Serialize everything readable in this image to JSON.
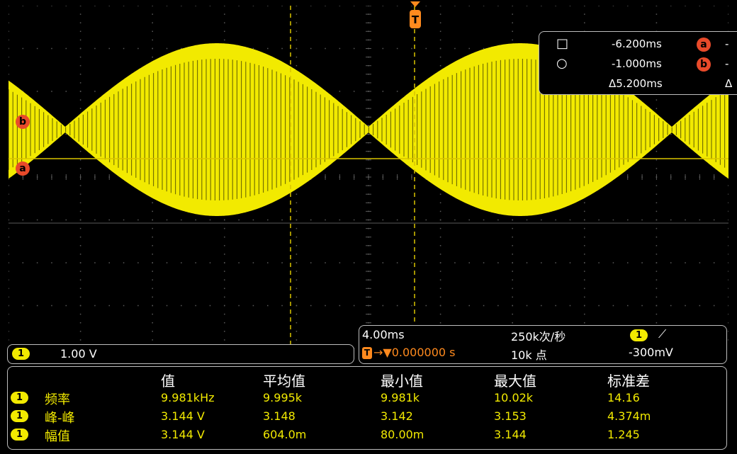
{
  "trigger_marker": "T",
  "cursor_a_label": "a",
  "cursor_b_label": "b",
  "cursor_readout": {
    "row1_symbol": "□",
    "row1_value": "-6.200ms",
    "row1_badge": "a",
    "row2_symbol": "○",
    "row2_value": "-1.000ms",
    "row2_badge": "b",
    "delta_value": "Δ5.200ms",
    "trailing_dash": "-",
    "trailing_delta": "Δ"
  },
  "channel": {
    "badge": "1",
    "scale": "1.00 V"
  },
  "timebase": {
    "time_per_div": "4.00ms",
    "sample_rate": "250k次/秒",
    "trigger_badge": "1",
    "trigger_slope": "⟋",
    "trigger_icon": "T",
    "trigger_offset": "→▼0.000000 s",
    "record_length": "10k 点",
    "trigger_level": "-300mV"
  },
  "measurements": {
    "headers": [
      "值",
      "平均值",
      "最小值",
      "最大值",
      "标准差"
    ],
    "rows": [
      {
        "badge": "1",
        "name": "频率",
        "values": [
          "9.981kHz",
          "9.995k",
          "9.981k",
          "10.02k",
          "14.16"
        ]
      },
      {
        "badge": "1",
        "name": "峰-峰",
        "values": [
          "3.144 V",
          "3.148",
          "3.142",
          "3.153",
          "4.374m"
        ]
      },
      {
        "badge": "1",
        "name": "幅值",
        "values": [
          "3.144 V",
          "604.0m",
          "80.00m",
          "3.144",
          "1.245"
        ]
      }
    ]
  },
  "colors": {
    "trace": "#f2ea00",
    "grid": "#5a5a5a",
    "cursor": "#d9c400",
    "trigger": "#ff8a1e",
    "cursor_badge": "#e84a2a"
  }
}
